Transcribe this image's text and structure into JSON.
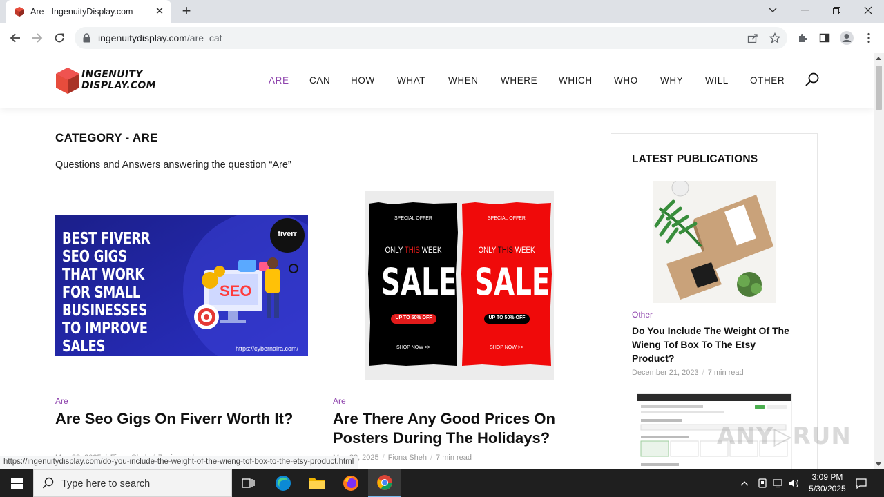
{
  "browser": {
    "tab_title": "Are - IngenuityDisplay.com",
    "url_domain": "ingenuitydisplay.com",
    "url_path": "/are_cat"
  },
  "site": {
    "logo_text": "INGENUITY\nDISPLAY.COM",
    "nav": [
      "ARE",
      "CAN",
      "HOW",
      "WHAT",
      "WHEN",
      "WHERE",
      "WHICH",
      "WHO",
      "WHY",
      "WILL",
      "OTHER"
    ],
    "active_nav": "ARE",
    "accent_color": "#8e44ad"
  },
  "category": {
    "title": "CATEGORY - ARE",
    "description": "Questions and Answers answering the question “Are”"
  },
  "posts": [
    {
      "category": "Are",
      "title": "Are Seo Gigs On Fiverr Worth It?",
      "date": "May 28, 2025",
      "author": "Fiona Sheh",
      "read_time": "7 min read",
      "image": {
        "headline": "BEST FIVERR SEO GIGS THAT WORK FOR SMALL BUSINESSES TO IMPROVE SALES",
        "badge": "fiverr",
        "screen_word": "SEO",
        "footer_url": "https://cybernaira.com/"
      }
    },
    {
      "category": "Are",
      "title": "Are There Any Good Prices On Posters During The Holidays?",
      "date": "May 28, 2025",
      "author": "Fiona Sheh",
      "read_time": "7 min read",
      "image": {
        "special_offer": "SPECIAL OFFER",
        "only": "ONLY",
        "this": "THIS",
        "week": "WEEK",
        "sale": "SALE",
        "discount": "UP TO 50% OFF",
        "shop_now": "SHOP NOW >>"
      }
    }
  ],
  "sidebar": {
    "title": "LATEST PUBLICATIONS",
    "items": [
      {
        "category": "Other",
        "title": "Do You Include The Weight Of The Wieng Tof Box To The Etsy Product?",
        "date": "December 21, 2023",
        "read_time": "7 min read"
      }
    ]
  },
  "status_url": "https://ingenuitydisplay.com/do-you-include-the-weight-of-the-wieng-tof-box-to-the-etsy-product.html",
  "watermark": "ANY▷RUN",
  "taskbar": {
    "search_placeholder": "Type here to search",
    "time": "3:09 PM",
    "date": "5/30/2025"
  }
}
